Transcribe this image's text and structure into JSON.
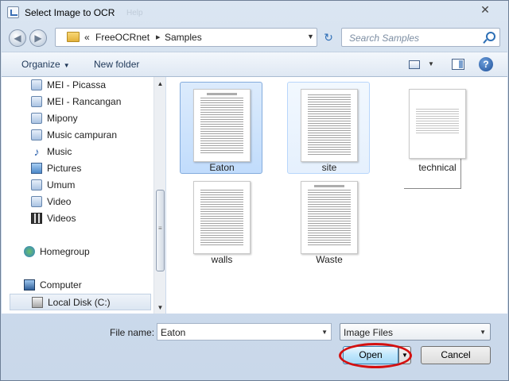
{
  "window": {
    "title": "Select Image to OCR",
    "close_label": "✕",
    "ghost_texts": [
      "Help"
    ]
  },
  "address": {
    "back_label": "◀",
    "forward_label": "▶",
    "prefix": "«",
    "crumbs": [
      "FreeOCRnet",
      "Samples"
    ],
    "separator": "▸",
    "refresh_label": "↻"
  },
  "search": {
    "placeholder": "Search Samples"
  },
  "toolbar": {
    "organize_label": "Organize",
    "organize_arrow": "▼",
    "new_folder_label": "New folder",
    "view_arrow": "▼",
    "help_label": "?"
  },
  "nav": {
    "items": [
      {
        "label": "MEI - Picassa",
        "icon": "library-icon"
      },
      {
        "label": "MEI - Rancangan",
        "icon": "library-icon"
      },
      {
        "label": "Mipony",
        "icon": "library-icon"
      },
      {
        "label": "Music campuran",
        "icon": "library-icon"
      },
      {
        "label": "Music",
        "icon": "music-icon"
      },
      {
        "label": "Pictures",
        "icon": "pictures-icon"
      },
      {
        "label": "Umum",
        "icon": "library-icon"
      },
      {
        "label": "Video",
        "icon": "library-icon"
      },
      {
        "label": "Videos",
        "icon": "videos-icon"
      },
      {
        "label": "Homegroup",
        "icon": "homegroup-icon"
      },
      {
        "label": "Computer",
        "icon": "computer-icon"
      },
      {
        "label": "Local Disk (C:)",
        "icon": "disk-icon"
      }
    ],
    "scroll_up": "▲",
    "scroll_down": "▼",
    "scroll_grip": "≡"
  },
  "files": [
    {
      "name": "Eaton",
      "state": "selected"
    },
    {
      "name": "site",
      "state": "hover"
    },
    {
      "name": "technical",
      "state": "normal"
    },
    {
      "name": "walls",
      "state": "normal"
    },
    {
      "name": "Waste",
      "state": "normal"
    }
  ],
  "bottom": {
    "file_name_label": "File name:",
    "file_name_value": "Eaton",
    "file_name_arrow": "▼",
    "file_type_value": "Image Files",
    "file_type_arrow": "▼",
    "open_label": "Open",
    "open_split_arrow": "▼",
    "cancel_label": "Cancel"
  },
  "colors": {
    "highlight_ellipse": "#d41010",
    "selection": "#c1dcfc"
  }
}
